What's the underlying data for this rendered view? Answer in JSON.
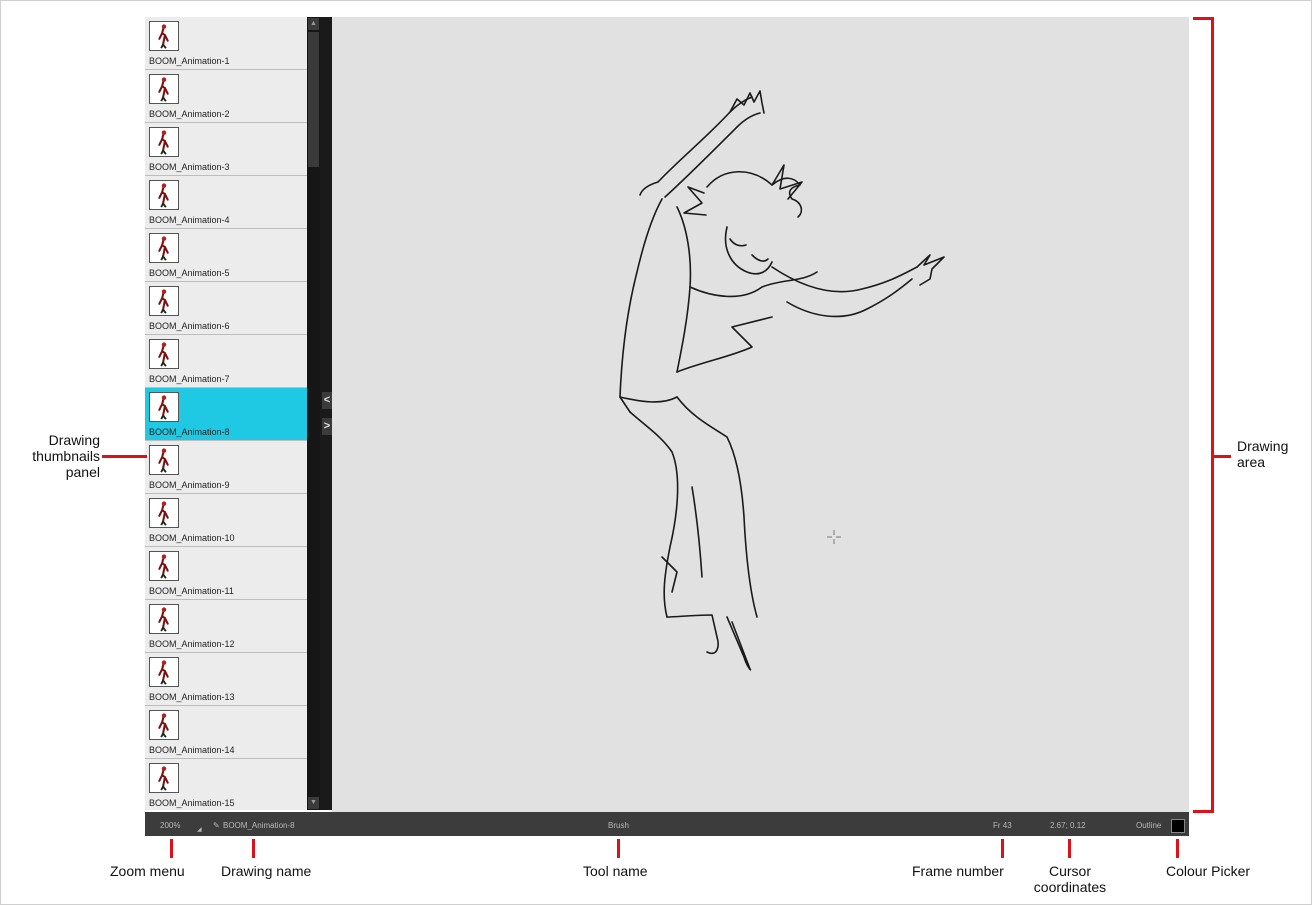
{
  "thumbnails": [
    {
      "label": "BOOM_Animation-1",
      "selected": false
    },
    {
      "label": "BOOM_Animation-2",
      "selected": false
    },
    {
      "label": "BOOM_Animation-3",
      "selected": false
    },
    {
      "label": "BOOM_Animation-4",
      "selected": false
    },
    {
      "label": "BOOM_Animation-5",
      "selected": false
    },
    {
      "label": "BOOM_Animation-6",
      "selected": false
    },
    {
      "label": "BOOM_Animation-7",
      "selected": false
    },
    {
      "label": "BOOM_Animation-8",
      "selected": true
    },
    {
      "label": "BOOM_Animation-9",
      "selected": false
    },
    {
      "label": "BOOM_Animation-10",
      "selected": false
    },
    {
      "label": "BOOM_Animation-11",
      "selected": false
    },
    {
      "label": "BOOM_Animation-12",
      "selected": false
    },
    {
      "label": "BOOM_Animation-13",
      "selected": false
    },
    {
      "label": "BOOM_Animation-14",
      "selected": false
    },
    {
      "label": "BOOM_Animation-15",
      "selected": false
    }
  ],
  "panel": {
    "collapse_left_icon": "chevron-left-icon",
    "collapse_right_icon": "chevron-right-icon"
  },
  "status_bar": {
    "zoom": "200%",
    "drawing_name": "BOOM_Animation-8",
    "tool_name": "Brush",
    "frame": "Fr 43",
    "coordinates": "2.67; 0.12",
    "view_mode": "Outline",
    "colour_picker": "#000000"
  },
  "callouts": {
    "thumbnails_panel": [
      "Drawing",
      "thumbnails",
      "panel"
    ],
    "drawing_area": [
      "Drawing",
      "area"
    ],
    "zoom_menu": "Zoom menu",
    "drawing_name": "Drawing name",
    "tool_name": "Tool name",
    "frame_number": "Frame number",
    "cursor_coordinates": [
      "Cursor",
      "coordinates"
    ],
    "colour_picker": "Colour Picker"
  },
  "colors": {
    "accent_selected": "#1fc9e3",
    "callout_red": "#e0101a"
  }
}
